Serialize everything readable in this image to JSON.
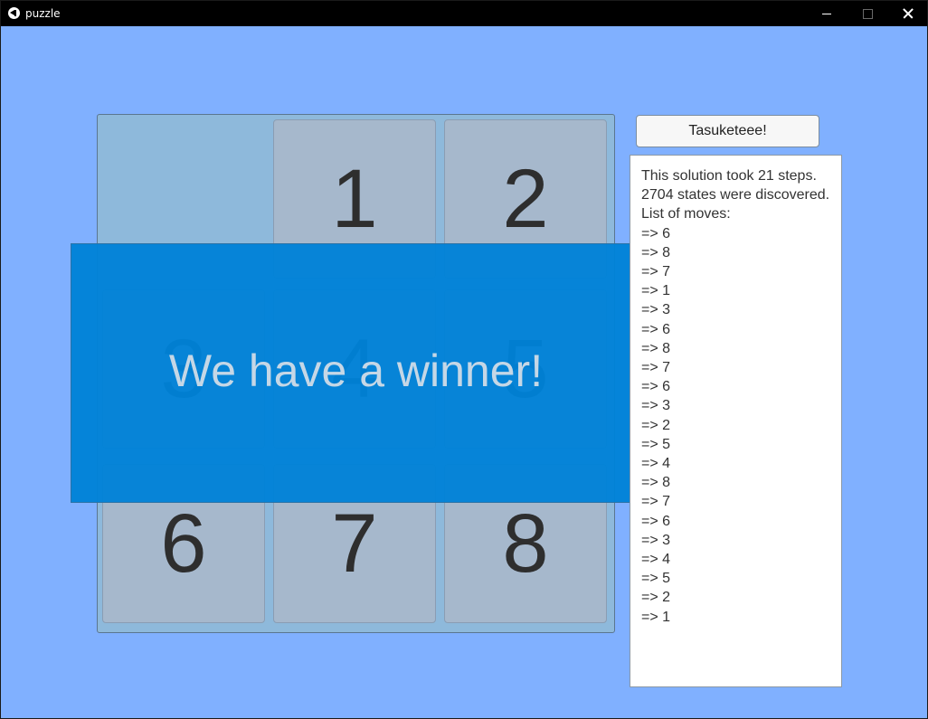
{
  "window": {
    "title": "puzzle"
  },
  "puzzle": {
    "tiles": [
      "",
      "1",
      "2",
      "3",
      "4",
      "5",
      "6",
      "7",
      "8"
    ]
  },
  "overlay": {
    "message": "We have a winner!"
  },
  "controls": {
    "solve_label": "Tasuketeee!"
  },
  "solution": {
    "steps_text": "This solution took 21 steps.",
    "states_text": "2704 states were discovered.",
    "moves_label": "List of moves:",
    "moves": [
      "=> 6",
      "=> 8",
      "=> 7",
      "=> 1",
      "=> 3",
      "=> 6",
      "=> 8",
      "=> 7",
      "=> 6",
      "=> 3",
      "=> 2",
      "=> 5",
      "=> 4",
      "=> 8",
      "=> 7",
      "=> 6",
      "=> 3",
      "=> 4",
      "=> 5",
      "=> 2",
      "=> 1"
    ]
  },
  "colors": {
    "background": "#80b0ff",
    "overlay": "#0087d7",
    "tile": "#a6b8cc"
  }
}
